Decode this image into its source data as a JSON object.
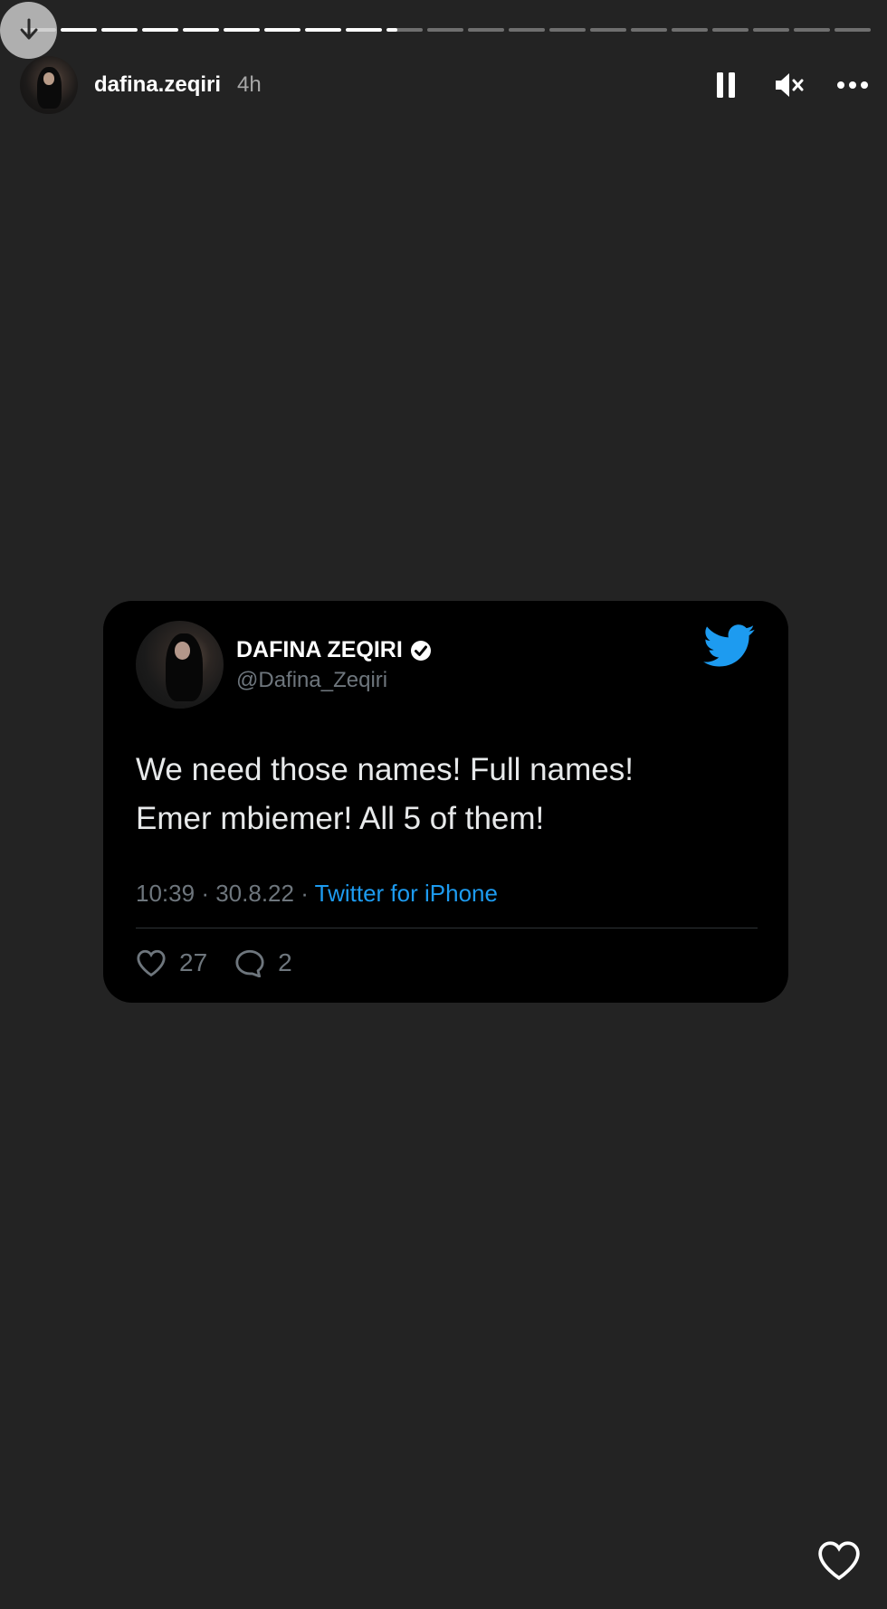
{
  "story": {
    "segments_total": 21,
    "segments_completed": 9,
    "current_segment_progress": 0.3
  },
  "header": {
    "username": "dafina.zeqiri",
    "time": "4h",
    "controls": {
      "pause_icon": "pause-icon",
      "mute_icon": "muted-speaker-icon",
      "more_icon": "ellipsis-icon"
    }
  },
  "tweet": {
    "name": "DAFINA ZEQIRI",
    "handle": "@Dafina_Zeqiri",
    "text_lines": [
      "We need those names! Full names!",
      "Emer mbiemer! All 5 of them!"
    ],
    "time": "10:39",
    "date": "30.8.22",
    "separator": "·",
    "source": "Twitter for iPhone",
    "likes": "27",
    "replies": "2"
  },
  "colors": {
    "background": "#232323",
    "card": "#000000",
    "twitter_blue": "#1d9bf0",
    "muted_text": "#6e767d"
  }
}
